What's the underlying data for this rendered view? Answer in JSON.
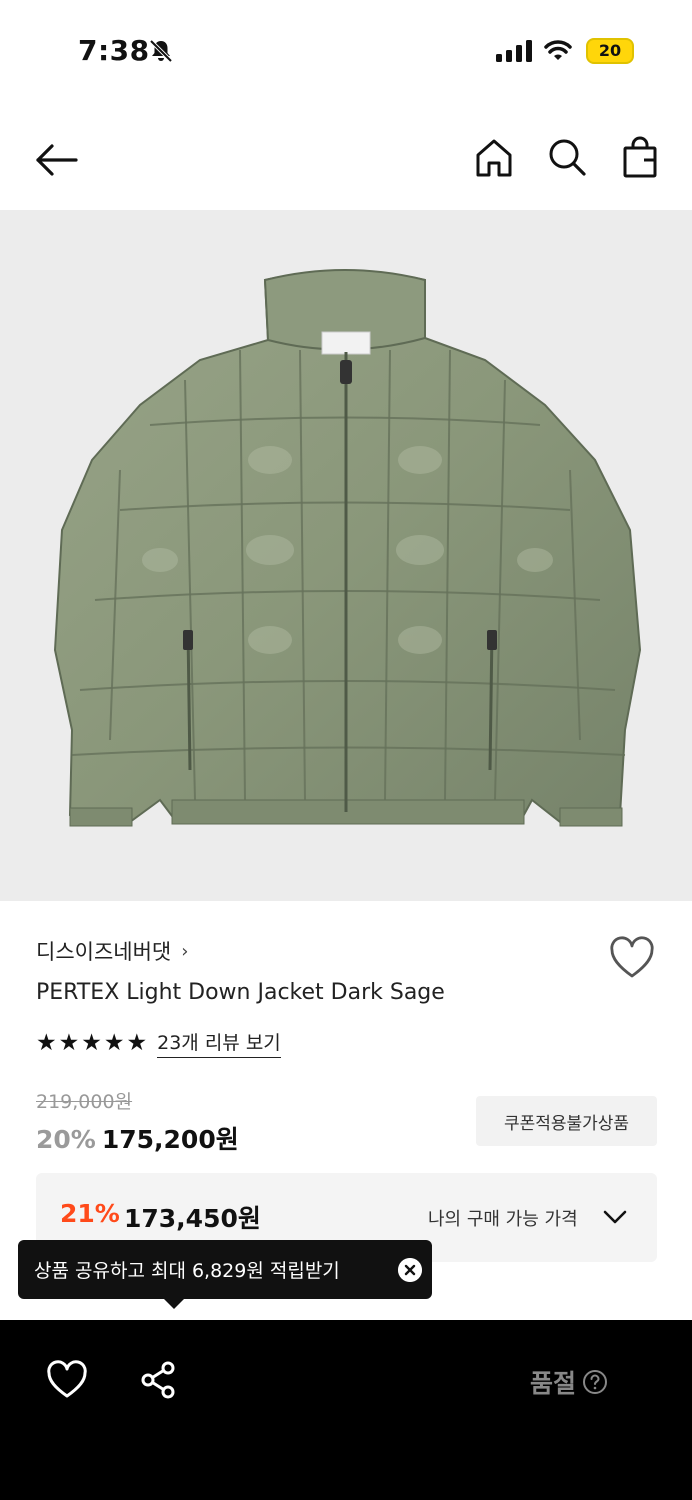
{
  "status_bar": {
    "time": "7:38",
    "battery": "20"
  },
  "header": {
    "icons": [
      "back-arrow-icon",
      "home-icon",
      "search-icon",
      "shopping-bag-icon"
    ]
  },
  "product": {
    "image_alt": "sage green quilted down jacket",
    "brand": "디스이즈네버댓",
    "brand_chevron": "›",
    "title": "PERTEX Light Down Jacket Dark Sage",
    "stars": [
      "★",
      "★",
      "★",
      "★",
      "★"
    ],
    "rating_fraction": 1.0,
    "review_link": "23개 리뷰 보기",
    "original_price": "219,000원",
    "discount_rate": "20%",
    "sale_price": "175,200원",
    "coupon_badge": "쿠폰적용불가상품"
  },
  "my_price": {
    "discount_rate": "21%",
    "price": "173,450원",
    "label": "나의 구매 가능 가격"
  },
  "tooltip": {
    "text": "상품 공유하고 최대 6,829원 적립받기"
  },
  "bottom_bar": {
    "status": "품절"
  },
  "colors": {
    "accent_discount": "#ff4a1a",
    "jacket": "#8a977a",
    "image_bg": "#ececec",
    "bottom_bar": "#000000"
  }
}
